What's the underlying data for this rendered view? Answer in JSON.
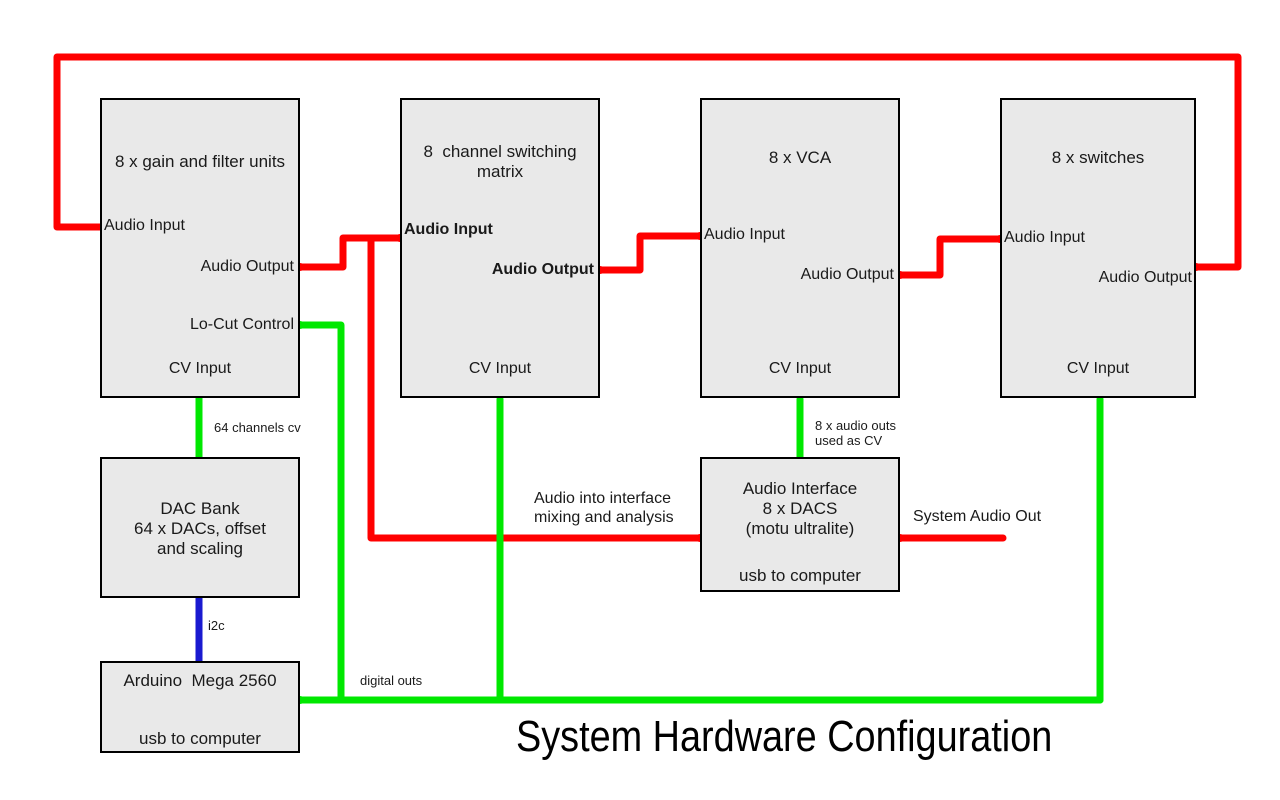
{
  "diagram": {
    "title": "System Hardware Configuration",
    "colors": {
      "audio_wire": "#ff0000",
      "cv_wire": "#00e800",
      "i2c_wire": "#1a1ad0",
      "box_fill": "#e9e9e9",
      "box_border": "#000000",
      "text": "#1a1a1a",
      "background": "#ffffff"
    }
  },
  "blocks": [
    {
      "id": "gain-filter",
      "title": "8 x gain and filter units",
      "ports": [
        {
          "label": "Audio Input",
          "bold": false
        },
        {
          "label": "Audio Output",
          "bold": false
        },
        {
          "label": "Lo-Cut Control",
          "bold": false
        },
        {
          "label": "CV Input",
          "bold": false
        }
      ]
    },
    {
      "id": "switching-matrix",
      "title": "8  channel switching\nmatrix",
      "ports": [
        {
          "label": "Audio Input",
          "bold": true
        },
        {
          "label": "Audio Output",
          "bold": true
        },
        {
          "label": "CV Input",
          "bold": false
        }
      ]
    },
    {
      "id": "vca",
      "title": "8 x VCA",
      "ports": [
        {
          "label": "Audio Input",
          "bold": false
        },
        {
          "label": "Audio Output",
          "bold": false
        },
        {
          "label": "CV Input",
          "bold": false
        }
      ]
    },
    {
      "id": "switches",
      "title": "8 x switches",
      "ports": [
        {
          "label": "Audio Input",
          "bold": false
        },
        {
          "label": "Audio Output",
          "bold": false
        },
        {
          "label": "CV Input",
          "bold": false
        }
      ]
    },
    {
      "id": "dac-bank",
      "title": "DAC Bank\n64 x DACs, offset\nand scaling",
      "ports": []
    },
    {
      "id": "arduino",
      "title": "Arduino  Mega 2560",
      "footer": "usb to computer",
      "ports": []
    },
    {
      "id": "audio-interface",
      "title": "Audio Interface\n8 x DACS\n(motu ultralite)",
      "footer": "usb to computer",
      "ports": []
    }
  ],
  "wire_labels": {
    "cv_64_channels": "64 channels cv",
    "i2c": "i2c",
    "digital_outs": "digital outs",
    "audio_outs_as_cv": "8 x audio outs\nused as CV",
    "audio_into_interface": "Audio into interface\nmixing and analysis",
    "system_audio_out": "System Audio Out"
  }
}
